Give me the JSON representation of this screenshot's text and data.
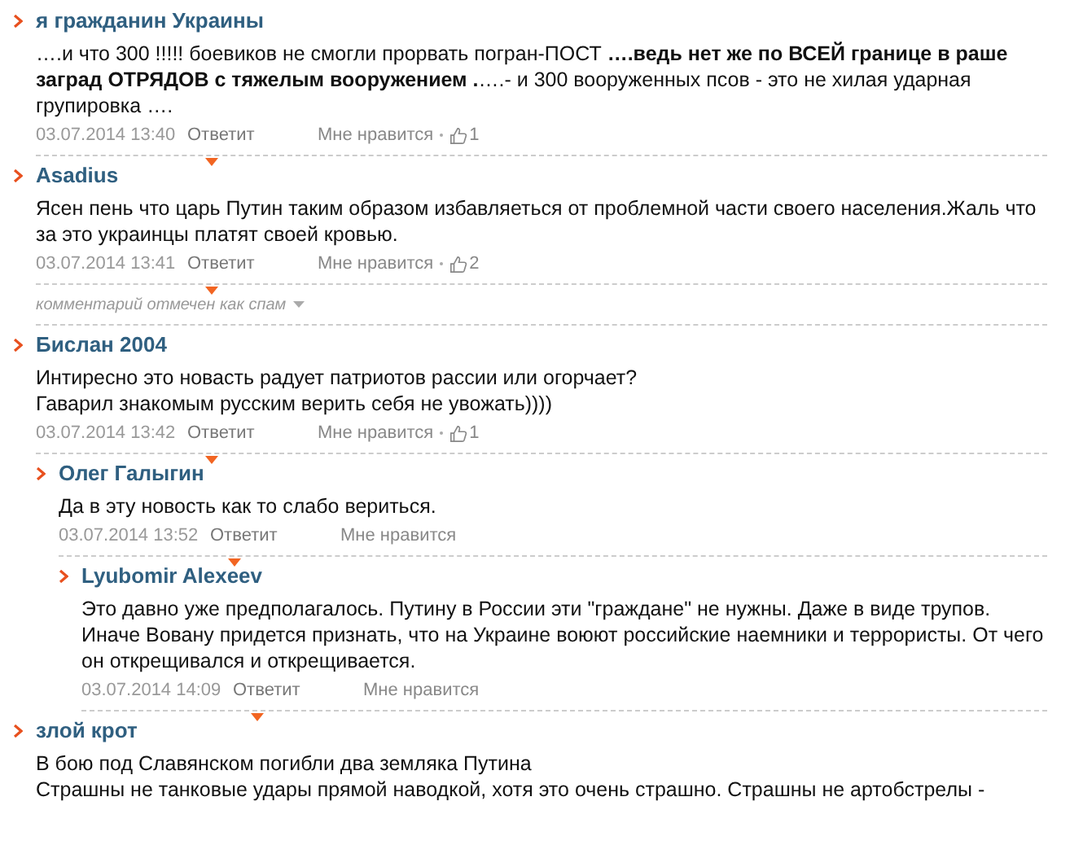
{
  "comments": [
    {
      "author": "я гражданин Украины",
      "text": "….и что 300 !!!!! боевиков не смогли прорвать погран-ПОСТ **….ведь нет же по ВСЕЙ границе в раше заград ОТРЯДОВ с тяжелым вооружением .**….- и 300 вооруженных псов - это не хилая ударная групировка ….",
      "date": "03.07.2014 13:40",
      "reply": "Ответит",
      "like": "Мне нравится",
      "likes": "1"
    },
    {
      "author": "Asadius",
      "text": "Ясен пень что царь Путин таким образом избавляеться от проблемной части своего населения.Жаль что за это украинцы платят своей кровью.",
      "date": "03.07.2014 13:41",
      "reply": "Ответит",
      "like": "Мне нравится",
      "likes": "2",
      "note": "комментарий отмечен как спам"
    },
    {
      "author": "Бислан 2004",
      "lines": [
        "Интиресно это новасть радует патриотов рассии или огорчает?",
        "Гаварил знакомым русским верить себя не увожать))))"
      ],
      "date": "03.07.2014 13:42",
      "reply": "Ответит",
      "like": "Мне нравится",
      "likes": "1",
      "children": [
        {
          "author": "Олег Галыгин",
          "text": "Да в эту новость как то слабо вериться.",
          "date": "03.07.2014 13:52",
          "reply": "Ответит",
          "like": "Мне нравится",
          "children": [
            {
              "author": "Lyubomir Alexeev",
              "text": "Это давно уже предполагалось. Путину в России эти \"граждане\" не нужны. Даже в виде трупов. Иначе Вовану придется признать, что на Украине воюют российские наемники и террористы. От чего он открещивался и открещивается.",
              "date": "03.07.2014 14:09",
              "reply": "Ответит",
              "like": "Мне нравится"
            }
          ]
        }
      ]
    },
    {
      "author": "злой крот",
      "lines": [
        "В бою под Славянском погибли два земляка Путина",
        "Страшны не танковые удары прямой наводкой, хотя это очень страшно. Страшны не артобстрелы -"
      ]
    }
  ]
}
